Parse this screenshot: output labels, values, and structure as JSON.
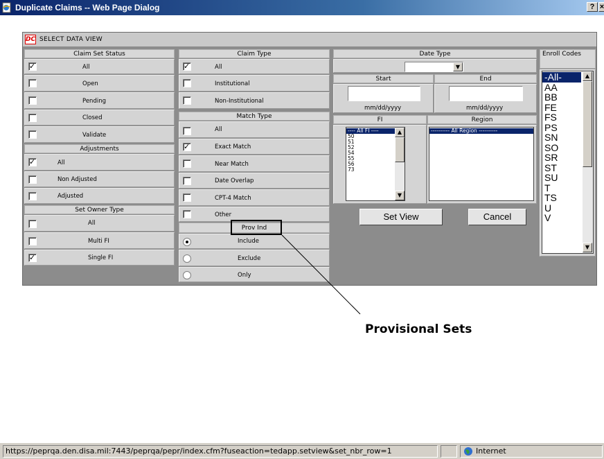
{
  "window": {
    "title": "Duplicate Claims -- Web Page Dialog",
    "help_button": "?",
    "close_button": "×"
  },
  "panel": {
    "header": "SELECT DATA VIEW",
    "logo_text": "DC"
  },
  "claim_set_status": {
    "heading": "Claim Set Status",
    "items": [
      {
        "label": "All",
        "checked": true
      },
      {
        "label": "Open",
        "checked": false
      },
      {
        "label": "Pending",
        "checked": false
      },
      {
        "label": "Closed",
        "checked": false
      },
      {
        "label": "Validate",
        "checked": false
      }
    ]
  },
  "adjustments": {
    "heading": "Adjustments",
    "items": [
      {
        "label": "All",
        "checked": true
      },
      {
        "label": "Non Adjusted",
        "checked": false
      },
      {
        "label": "Adjusted",
        "checked": false
      }
    ]
  },
  "set_owner_type": {
    "heading": "Set Owner Type",
    "items": [
      {
        "label": "All",
        "checked": false
      },
      {
        "label": "Multi FI",
        "checked": false
      },
      {
        "label": "Single FI",
        "checked": true
      }
    ]
  },
  "claim_type": {
    "heading": "Claim Type",
    "items": [
      {
        "label": "All",
        "checked": true
      },
      {
        "label": "Institutional",
        "checked": false
      },
      {
        "label": "Non-Institutional",
        "checked": false
      }
    ]
  },
  "match_type": {
    "heading": "Match Type",
    "items": [
      {
        "label": "All",
        "checked": false
      },
      {
        "label": "Exact Match",
        "checked": true
      },
      {
        "label": "Near Match",
        "checked": false
      },
      {
        "label": "Date Overlap",
        "checked": false
      },
      {
        "label": "CPT-4 Match",
        "checked": false
      },
      {
        "label": "Other",
        "checked": false
      }
    ]
  },
  "prov_ind": {
    "heading": "Prov Ind",
    "items": [
      {
        "label": "Include",
        "selected": true
      },
      {
        "label": "Exclude",
        "selected": false
      },
      {
        "label": "Only",
        "selected": false
      }
    ]
  },
  "date_type": {
    "heading": "Date Type",
    "select_value": "",
    "start_label": "Start",
    "end_label": "End",
    "start_value": "",
    "end_value": "",
    "start_hint": "mm/dd/yyyy",
    "end_hint": "mm/dd/yyyy"
  },
  "fi": {
    "heading": "FI",
    "options": [
      "---- All FI ----",
      "50",
      "51",
      "52",
      "54",
      "55",
      "56",
      "73"
    ],
    "selected": 0
  },
  "region": {
    "heading": "Region",
    "options": [
      "---------- All Region ----------"
    ],
    "selected": 0
  },
  "buttons": {
    "set_view": "Set View",
    "cancel": "Cancel"
  },
  "enroll_codes": {
    "heading": "Enroll Codes",
    "options": [
      "-All-",
      "AA",
      "BB",
      "FE",
      "FS",
      "PS",
      "SN",
      "SO",
      "SR",
      "ST",
      "SU",
      "T",
      "TS",
      "U",
      "V"
    ],
    "selected": 0
  },
  "annotation": {
    "text": "Provisional Sets"
  },
  "statusbar": {
    "url": "https://peprqa.den.disa.mil:7443/peprqa/pepr/index.cfm?fuseaction=tedapp.setview&set_nbr_row=1",
    "zone": "Internet"
  }
}
